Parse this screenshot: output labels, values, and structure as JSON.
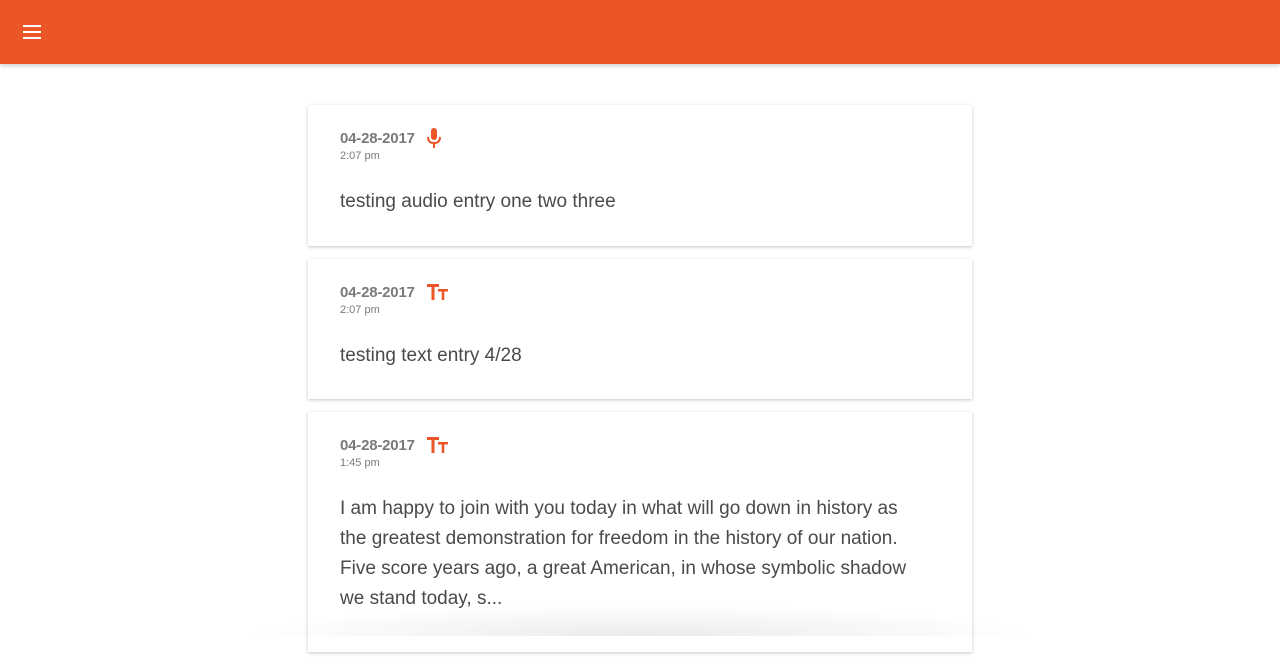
{
  "colors": {
    "brand": "#ec5527",
    "meta_text": "#7a7a7a",
    "body_text": "#4a4a4a"
  },
  "header": {
    "menu_icon": "hamburger-menu-icon"
  },
  "entries": [
    {
      "date": "04-28-2017",
      "time": "2:07 pm",
      "type_icon": "microphone-icon",
      "text": "testing audio entry one two three"
    },
    {
      "date": "04-28-2017",
      "time": "2:07 pm",
      "type_icon": "text-format-icon",
      "text": "testing text entry 4/28"
    },
    {
      "date": "04-28-2017",
      "time": "1:45 pm",
      "type_icon": "text-format-icon",
      "text": "I am happy to join with you today in what will go down in history as the greatest demonstration for freedom in the history of our nation. Five score years ago, a great American, in whose symbolic shadow we stand today, s..."
    }
  ]
}
